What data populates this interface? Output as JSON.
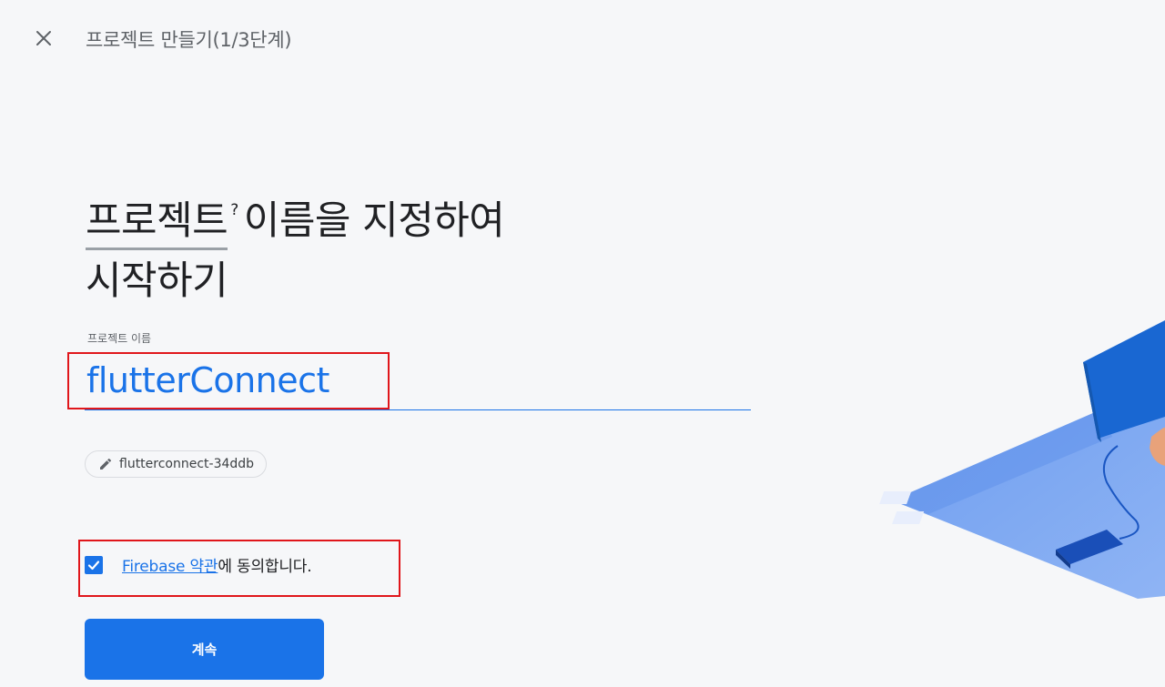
{
  "header": {
    "title": "프로젝트 만들기(1/3단계)",
    "close_icon": "close-icon"
  },
  "heading": {
    "word": "프로젝트",
    "help_symbol": "?",
    "rest_line1": "이름을 지정하여",
    "line2": "시작하기"
  },
  "name_field": {
    "label": "프로젝트 이름",
    "value": "flutterConnect"
  },
  "project_id": {
    "value": "flutterconnect-34ddb",
    "icon": "pencil-icon"
  },
  "terms": {
    "checked": true,
    "link_text": "Firebase 약관",
    "suffix": "에 동의합니다."
  },
  "continue_button": {
    "label": "계속"
  },
  "colors": {
    "accent": "#1a73e8",
    "highlight": "#e0161b",
    "background": "#f6f7f9"
  }
}
